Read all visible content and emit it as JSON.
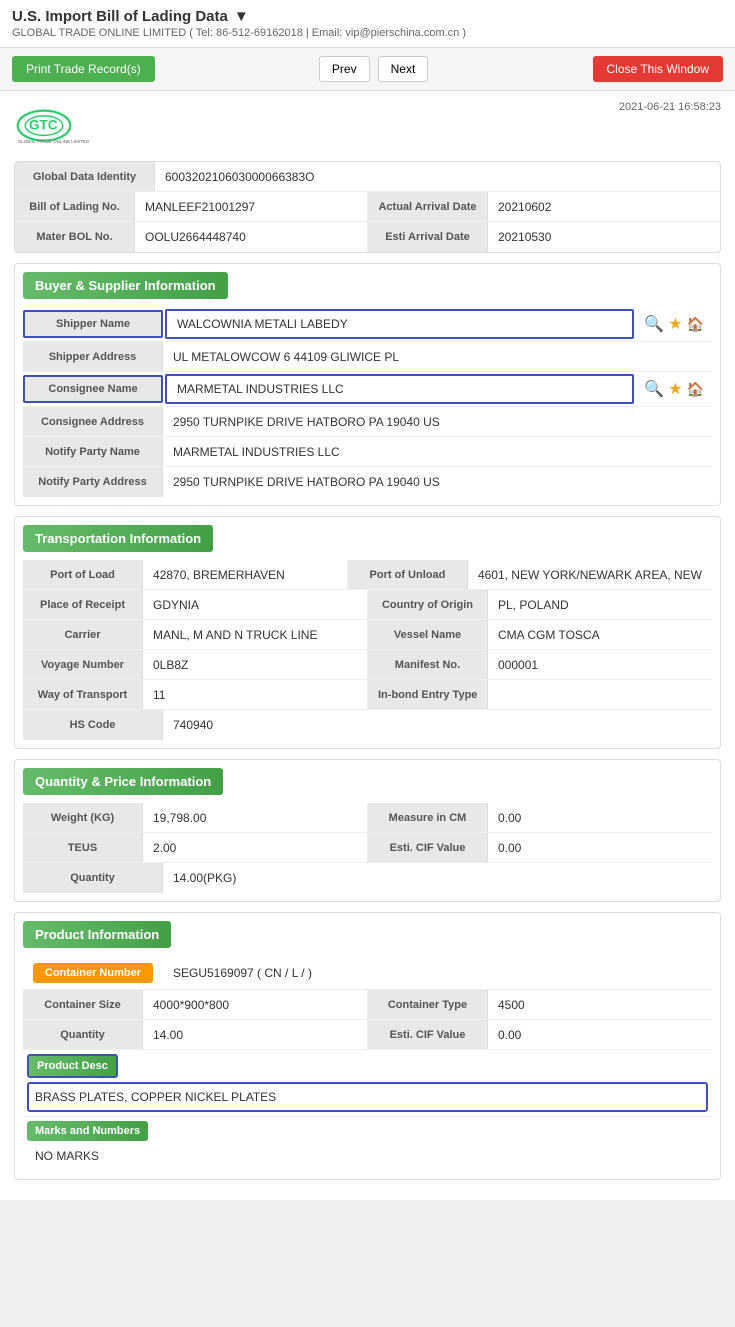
{
  "topbar": {
    "title": "U.S. Import Bill of Lading Data",
    "subtitle": "GLOBAL TRADE ONLINE LIMITED ( Tel: 86-512-69162018 | Email: vip@pierschina.com.cn )",
    "print_btn": "Print Trade Record(s)",
    "prev_btn": "Prev",
    "next_btn": "Next",
    "close_btn": "Close This Window"
  },
  "logo": {
    "timestamp": "2021-06-21 16:58:23"
  },
  "basic_info": {
    "global_data_label": "Global Data Identity",
    "global_data_value": "600320210603000066383O",
    "bol_label": "Bill of Lading No.",
    "bol_value": "MANLEEF21001297",
    "arrival_label": "Actual Arrival Date",
    "arrival_value": "20210602",
    "master_label": "Mater BOL No.",
    "master_value": "OOLU2664448740",
    "esti_label": "Esti Arrival Date",
    "esti_value": "20210530"
  },
  "buyer_supplier": {
    "section_title": "Buyer & Supplier Information",
    "shipper_name_label": "Shipper Name",
    "shipper_name_value": "WALCOWNIA METALI LABEDY",
    "shipper_addr_label": "Shipper Address",
    "shipper_addr_value": "UL METALOWCOW 6 44109 GLIWICE PL",
    "consignee_name_label": "Consignee Name",
    "consignee_name_value": "MARMETAL INDUSTRIES LLC",
    "consignee_addr_label": "Consignee Address",
    "consignee_addr_value": "2950 TURNPIKE DRIVE HATBORO PA 19040 US",
    "notify_name_label": "Notify Party Name",
    "notify_name_value": "MARMETAL INDUSTRIES LLC",
    "notify_addr_label": "Notify Party Address",
    "notify_addr_value": "2950 TURNPIKE DRIVE HATBORO PA 19040 US"
  },
  "transportation": {
    "section_title": "Transportation Information",
    "port_load_label": "Port of Load",
    "port_load_value": "42870, BREMERHAVEN",
    "port_unload_label": "Port of Unload",
    "port_unload_value": "4601, NEW YORK/NEWARK AREA, NEW",
    "receipt_label": "Place of Receipt",
    "receipt_value": "GDYNIA",
    "origin_label": "Country of Origin",
    "origin_value": "PL, POLAND",
    "carrier_label": "Carrier",
    "carrier_value": "MANL, M AND N TRUCK LINE",
    "vessel_label": "Vessel Name",
    "vessel_value": "CMA CGM TOSCA",
    "voyage_label": "Voyage Number",
    "voyage_value": "0LB8Z",
    "manifest_label": "Manifest No.",
    "manifest_value": "000001",
    "way_label": "Way of Transport",
    "way_value": "11",
    "inbond_label": "In-bond Entry Type",
    "inbond_value": "",
    "hs_label": "HS Code",
    "hs_value": "740940"
  },
  "quantity_price": {
    "section_title": "Quantity & Price Information",
    "weight_label": "Weight (KG)",
    "weight_value": "19,798.00",
    "measure_label": "Measure in CM",
    "measure_value": "0.00",
    "teus_label": "TEUS",
    "teus_value": "2.00",
    "cif_label": "Esti. CIF Value",
    "cif_value": "0.00",
    "qty_label": "Quantity",
    "qty_value": "14.00(PKG)"
  },
  "product": {
    "section_title": "Product Information",
    "container_num_label": "Container Number",
    "container_num_value": "SEGU5169097 ( CN / L / )",
    "container_size_label": "Container Size",
    "container_size_value": "4000*900*800",
    "container_type_label": "Container Type",
    "container_type_value": "4500",
    "qty_label": "Quantity",
    "qty_value": "14.00",
    "esti_cif_label": "Esti. CIF Value",
    "esti_cif_value": "0.00",
    "desc_label": "Product Desc",
    "desc_value": "BRASS PLATES, COPPER NICKEL PLATES",
    "marks_label": "Marks and Numbers",
    "marks_value": "NO MARKS"
  }
}
